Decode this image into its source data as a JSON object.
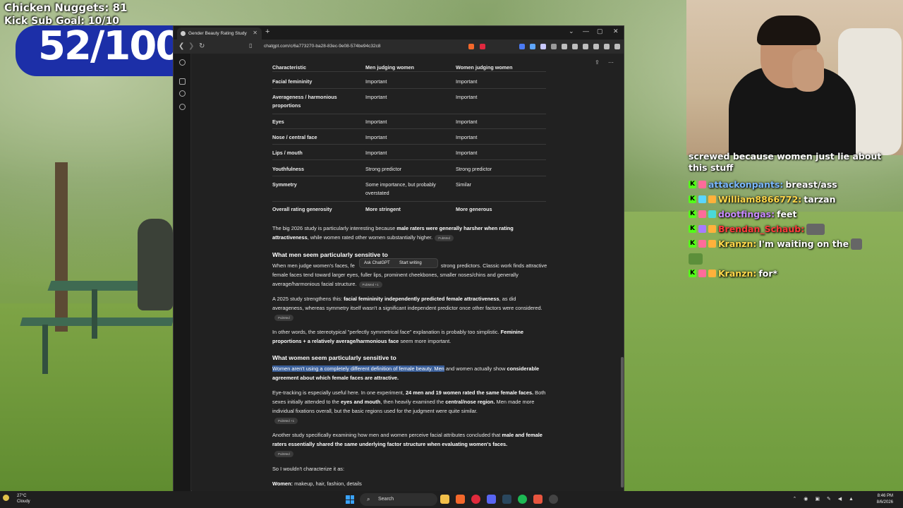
{
  "overlay": {
    "nuggets": "Chicken Nuggets: 81",
    "kick_goal": "Kick Sub Goal: 10/10",
    "counter": "52/100"
  },
  "chat": {
    "top_text": "screwed because women just lie about this stuff",
    "messages": [
      {
        "user": "attackonpants:",
        "text": "breast/ass",
        "color": "blue"
      },
      {
        "user": "William8866772:",
        "text": "tarzan",
        "color": "yellow"
      },
      {
        "user": "dootfingas:",
        "text": "feet",
        "color": "purple"
      },
      {
        "user": "Brendan_Schaub:",
        "text": "",
        "color": "red"
      },
      {
        "user": "Kranzn:",
        "text": "I'm waiting on the",
        "color": "yellow"
      },
      {
        "user": "Kranzn:",
        "text": "for*",
        "color": "yellow"
      }
    ]
  },
  "browser": {
    "tab_title": "Gender Beauty Rating Study",
    "url": "chatgpt.com/c/6a773270-ba28-83ec-9e08-574be94c32c8",
    "table": {
      "headers": [
        "Characteristic",
        "Men judging women",
        "Women judging women"
      ],
      "rows": [
        [
          "Facial femininity",
          "Important",
          "Important"
        ],
        [
          "Averageness / harmonious proportions",
          "Important",
          "Important"
        ],
        [
          "Eyes",
          "Important",
          "Important"
        ],
        [
          "Nose / central face",
          "Important",
          "Important"
        ],
        [
          "Lips / mouth",
          "Important",
          "Important"
        ],
        [
          "Youthfulness",
          "Strong predictor",
          "Strong predictor"
        ],
        [
          "Symmetry",
          "Some importance, but probably overstated",
          "Similar"
        ],
        [
          "Overall rating generosity",
          "More stringent",
          "More generous"
        ]
      ]
    },
    "p1_a": "The big 2026 study is particularly interesting because ",
    "p1_b": "male raters were generally harsher when rating attractiveness",
    "p1_c": ", while women rated other women substantially higher.",
    "pill": "PubMed",
    "pill_plus": "PubMed +1",
    "h1": "What men seem particularly sensitive to",
    "p2_a": "When men judge women's faces, fe",
    "p2_b": " strong predictors. Classic work finds attractive female faces tend toward larger eyes, fuller lips, prominent cheekbones, smaller noses/chins and generally average/harmonious facial structure.",
    "popup": {
      "ask": "Ask ChatGPT",
      "write": "Start writing"
    },
    "p3_a": "A 2025 study strengthens this: ",
    "p3_b": "facial femininity independently predicted female attractiveness",
    "p3_c": ", as did averageness, whereas symmetry itself wasn't a significant independent predictor once other factors were considered.",
    "p4_a": "In other words, the stereotypical \"perfectly symmetrical face\" explanation is probably too simplistic. ",
    "p4_b": "Feminine proportions + a relatively average/harmonious face",
    "p4_c": " seem more important.",
    "h2": "What women seem particularly sensitive to",
    "p5_hl": "Women aren't using a completely different definition of female beauty. Men",
    "p5_a": " and women actually show ",
    "p5_b": "considerable agreement about which female faces are attractive.",
    "p6_a": "Eye-tracking is especially useful here. In one experiment, ",
    "p6_b": "24 men and 19 women rated the same female faces.",
    "p6_c": " Both sexes initially attended to the ",
    "p6_d": "eyes and mouth",
    "p6_e": ", then heavily examined the ",
    "p6_f": "central/nose region.",
    "p6_g": " Men made more individual fixations overall, but the basic regions used for the judgment were quite similar.",
    "p7_a": "Another study specifically examining how men and women perceive facial attributes concluded that ",
    "p7_b": "male and female raters essentially shared the same underlying factor structure when evaluating women's faces.",
    "p8": "So I wouldn't characterize it as:",
    "p9_a": "Women:",
    "p9_b": " makeup, hair, fashion, details"
  },
  "taskbar": {
    "temp": "27°C",
    "weather": "Cloudy",
    "search": "Search",
    "time": "8:46 PM",
    "date": "8/6/2026"
  }
}
